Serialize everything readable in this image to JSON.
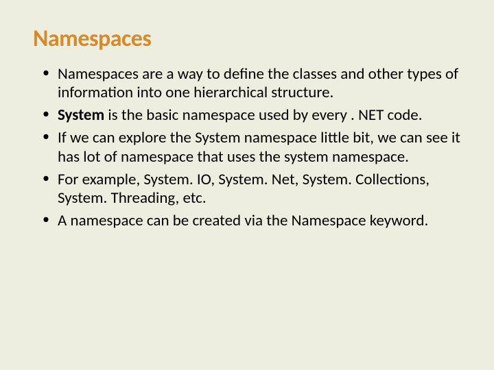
{
  "title": "Namespaces",
  "bullets": {
    "b0": "Namespaces are a way to define the classes and other types of information into one hierarchical structure.",
    "b1_pre": "",
    "b1_bold": "System",
    "b1_post": " is the basic namespace used by every . NET code.",
    "b2": "If we can explore the System namespace little bit, we can see it has lot of namespace that uses the system namespace.",
    "b3": "For example, System. IO, System. Net, System. Collections, System. Threading, etc.",
    "b4": "A namespace can be created via the Namespace keyword."
  }
}
